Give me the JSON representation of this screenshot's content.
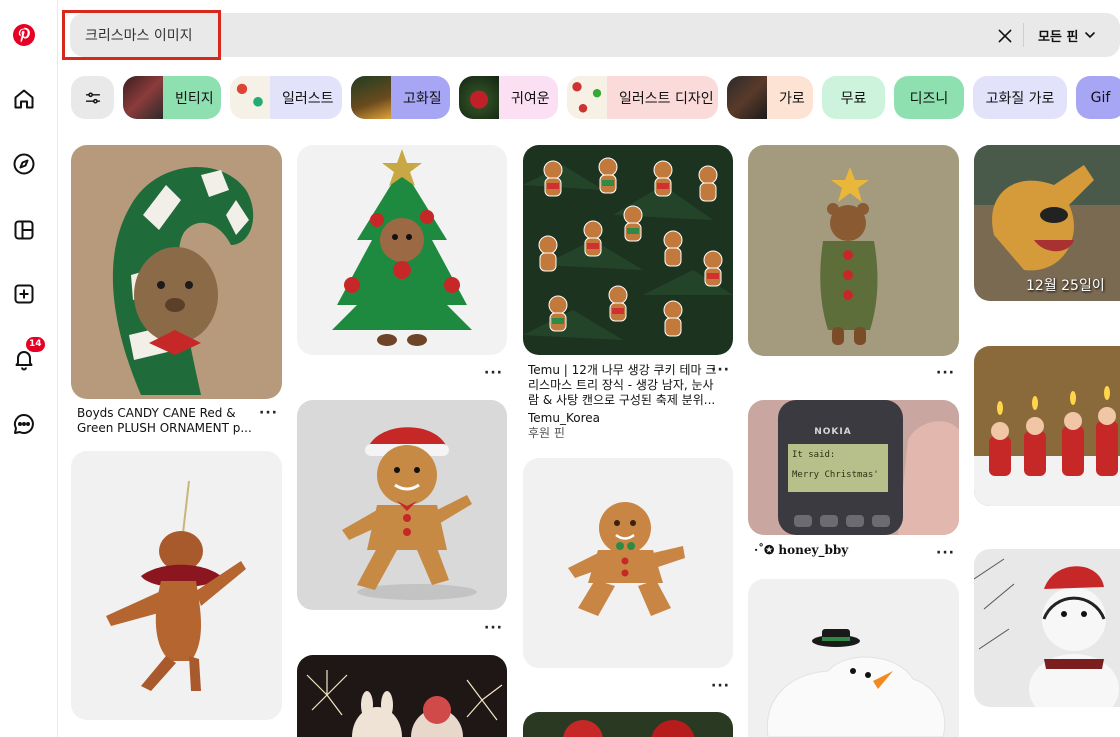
{
  "search": {
    "query": "크리스마스 이미지",
    "filter_label": "모든 핀"
  },
  "sidebar": {
    "notification_count": "14"
  },
  "chips": [
    {
      "label": "빈티지",
      "color": "#8fe0b0"
    },
    {
      "label": "일러스트",
      "color": "#e3e2fb"
    },
    {
      "label": "고화질",
      "color": "#a7a6f5"
    },
    {
      "label": "귀여운",
      "color": "#fbe0f4"
    },
    {
      "label": "일러스트 디자인",
      "color": "#fbdada"
    },
    {
      "label": "가로",
      "color": "#fde3d3"
    },
    {
      "label": "무료",
      "color": "#cdf3dc"
    },
    {
      "label": "디즈니",
      "color": "#8fe0b0"
    },
    {
      "label": "고화질 가로",
      "color": "#e3e2fb"
    },
    {
      "label": "Gif",
      "color": "#a7a6f5"
    }
  ],
  "pins": {
    "boyds": {
      "title": "Boyds CANDY CANE Red & Green PLUSH ORNAMENT p..."
    },
    "temu": {
      "title": "Temu | 12개 나무 생강 쿠키 테마 크리스마스 트리 장식 - 생강 남자, 눈사람 & 사탕 캔으로 구성된 축제 분위...",
      "author": "Temu_Korea",
      "promoted": "후원 핀"
    },
    "nokia": {
      "brand": "NOKIA",
      "screen_line1": "It said:",
      "screen_line2": "Merry Christmas'",
      "author": "·˚✪ honey_bby"
    },
    "pluto": {
      "caption": "12월 25일이"
    }
  },
  "more_label": "···"
}
